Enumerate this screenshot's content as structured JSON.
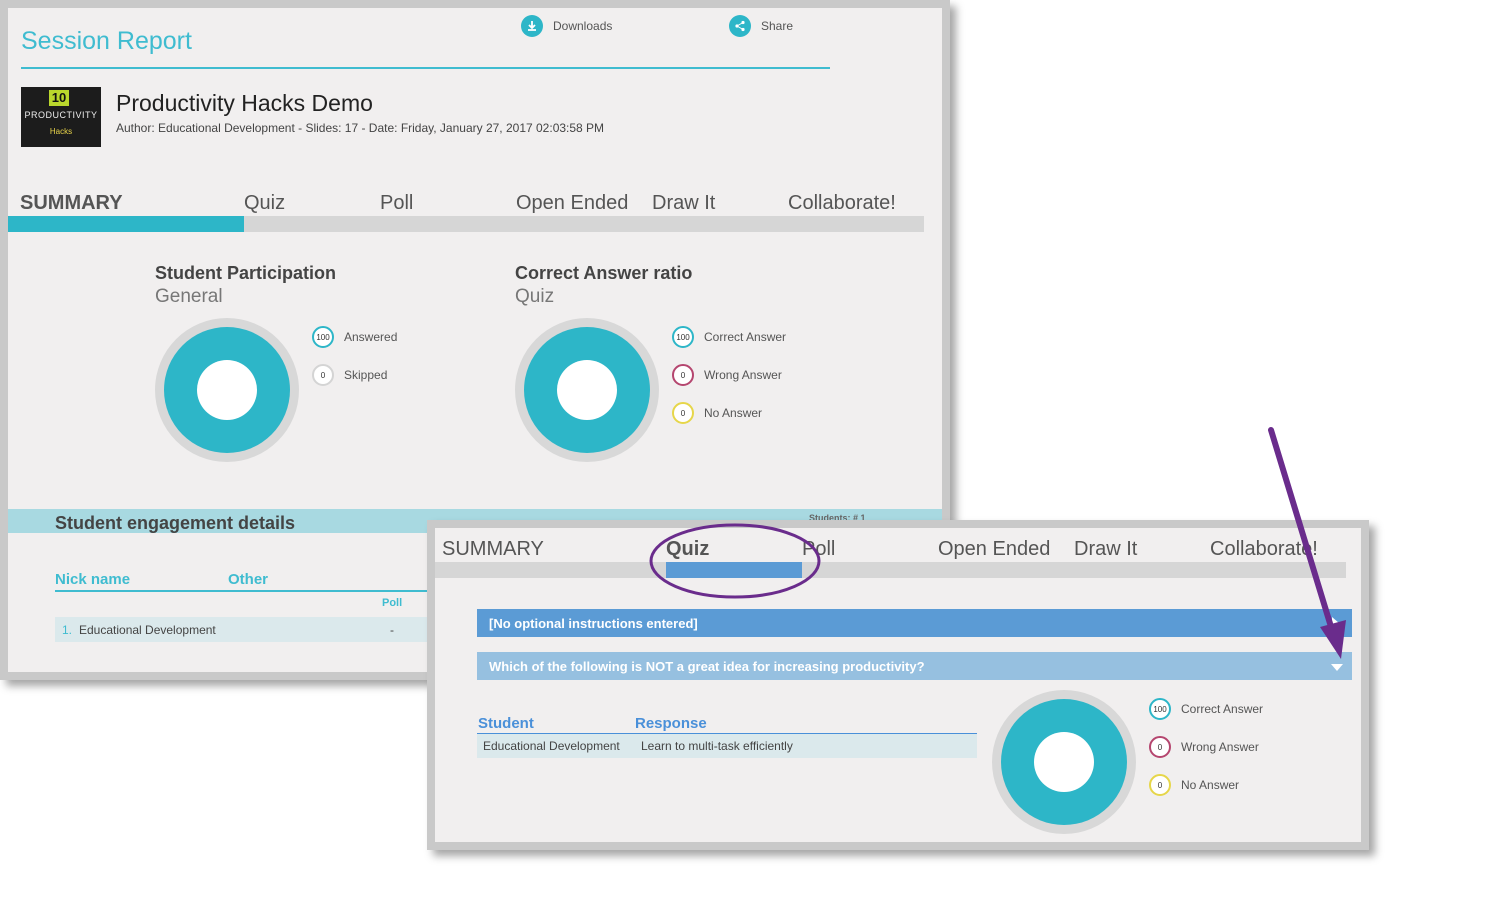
{
  "report": {
    "title": "Session Report",
    "downloads_label": "Downloads",
    "share_label": "Share",
    "thumbnail": {
      "number": "10",
      "word": "PRODUCTIVITY",
      "sub": "Hacks"
    },
    "deck_title": "Productivity Hacks Demo",
    "deck_meta": "Author: Educational Development - Slides: 17 - Date: Friday, January 27, 2017 02:03:58 PM"
  },
  "tabs": [
    "SUMMARY",
    "Quiz",
    "Poll",
    "Open Ended",
    "Draw It",
    "Collaborate!"
  ],
  "participation": {
    "title": "Student Participation",
    "subtitle": "General",
    "legend": [
      {
        "value": "100",
        "label": "Answered",
        "color": "#2db6c8"
      },
      {
        "value": "0",
        "label": "Skipped",
        "color": "#d4d4d4"
      }
    ]
  },
  "correct_ratio": {
    "title": "Correct Answer ratio",
    "subtitle": "Quiz",
    "legend": [
      {
        "value": "100",
        "label": "Correct Answer",
        "color": "#2db6c8"
      },
      {
        "value": "0",
        "label": "Wrong Answer",
        "color": "#b5466f"
      },
      {
        "value": "0",
        "label": "No Answer",
        "color": "#e6d64a"
      }
    ]
  },
  "engagement": {
    "title": "Student engagement details",
    "students_count": "Students: # 1",
    "col_nick": "Nick name",
    "col_other": "Other",
    "sub_poll": "Poll",
    "rows": [
      {
        "index": "1.",
        "name": "Educational Development",
        "poll": "-"
      }
    ]
  },
  "quiz_view": {
    "instructions": "[No optional instructions entered]",
    "question": "Which of the following is NOT a great idea for increasing productivity?",
    "col_student": "Student",
    "col_response": "Response",
    "rows": [
      {
        "student": "Educational Development",
        "response": "Learn to multi-task efficiently"
      }
    ],
    "legend": [
      {
        "value": "100",
        "label": "Correct Answer",
        "color": "#2db6c8"
      },
      {
        "value": "0",
        "label": "Wrong Answer",
        "color": "#b5466f"
      },
      {
        "value": "0",
        "label": "No Answer",
        "color": "#e6d64a"
      }
    ]
  },
  "colors": {
    "teal": "#2db6c8",
    "blue": "#5b9bd5",
    "annotation_purple": "#6a2c8c"
  }
}
